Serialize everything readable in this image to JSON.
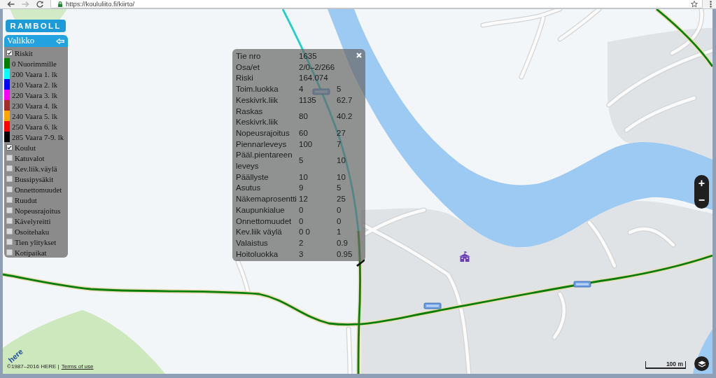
{
  "browser": {
    "url": "https://koululiito.fi/kiirto/"
  },
  "logo": {
    "text": "RAMBOLL"
  },
  "menu": {
    "title": "Valikko",
    "items": [
      {
        "kind": "checkbox",
        "label": "Riskit",
        "checked": true
      },
      {
        "kind": "legend",
        "label": "0 Nuorimmille",
        "color": "#008000"
      },
      {
        "kind": "legend",
        "label": "200 Vaara 1. lk",
        "color": "#00ffff"
      },
      {
        "kind": "legend",
        "label": "210 Vaara 2. lk",
        "color": "#0000ff"
      },
      {
        "kind": "legend",
        "label": "220 Vaara 3. lk",
        "color": "#ff00ff"
      },
      {
        "kind": "legend",
        "label": "230 Vaara 4. lk",
        "color": "#a52a2a"
      },
      {
        "kind": "legend",
        "label": "240 Vaara 5. lk",
        "color": "#ffa500"
      },
      {
        "kind": "legend",
        "label": "250 Vaara 6. lk",
        "color": "#ff0000"
      },
      {
        "kind": "legend",
        "label": "285 Vaara 7-9. lk",
        "color": "#000000"
      },
      {
        "kind": "checkbox",
        "label": "Koulut",
        "checked": true
      },
      {
        "kind": "checkbox",
        "label": "Katuvalot",
        "checked": false
      },
      {
        "kind": "checkbox",
        "label": "Kev.liik.väylä",
        "checked": false
      },
      {
        "kind": "checkbox",
        "label": "Bussipysäkit",
        "checked": false
      },
      {
        "kind": "checkbox",
        "label": "Onnettomuudet",
        "checked": false
      },
      {
        "kind": "checkbox",
        "label": "Ruudut",
        "checked": false
      },
      {
        "kind": "checkbox",
        "label": "Nopeusrajoitus",
        "checked": false
      },
      {
        "kind": "checkbox",
        "label": "Kävelyreitti",
        "checked": false
      },
      {
        "kind": "checkbox",
        "label": "Osoitehaku",
        "checked": false
      },
      {
        "kind": "checkbox",
        "label": "Tien ylitykset",
        "checked": false
      },
      {
        "kind": "checkbox",
        "label": "Kotipaikat",
        "checked": false
      }
    ]
  },
  "popup": {
    "rows": [
      {
        "label": "Tie nro",
        "values": [
          "1635"
        ]
      },
      {
        "label": "Osa/et",
        "values": [
          "2/0–2/266"
        ]
      },
      {
        "label": "Riski",
        "values": [
          "164.074"
        ]
      },
      {
        "label": "Toim.luokka",
        "values": [
          "4",
          "5"
        ]
      },
      {
        "label": "Keskivrk.liik",
        "values": [
          "1135",
          "62.7"
        ]
      },
      {
        "label": "Raskas Keskivrk.liik",
        "values": [
          "80",
          "40.2"
        ]
      },
      {
        "label": "Nopeusrajoitus",
        "values": [
          "60",
          "27"
        ]
      },
      {
        "label": "Piennarleveys",
        "values": [
          "100",
          "7"
        ]
      },
      {
        "label": "Pääl.pientareen leveys",
        "values": [
          "5",
          "10"
        ]
      },
      {
        "label": "Päällyste",
        "values": [
          "10",
          "10"
        ]
      },
      {
        "label": "Asutus",
        "values": [
          "9",
          "5"
        ]
      },
      {
        "label": "Näkemaprosentti",
        "values": [
          "12",
          "25"
        ]
      },
      {
        "label": "Kaupunkialue",
        "values": [
          "0",
          "0"
        ]
      },
      {
        "label": "Onnettomuudet",
        "values": [
          "0",
          "0"
        ]
      },
      {
        "label": "Kev.liik väylä",
        "values": [
          "0 0",
          "1"
        ]
      },
      {
        "label": "Valaistus",
        "values": [
          "2",
          "0.9"
        ]
      },
      {
        "label": "Hoitoluokka",
        "values": [
          "3",
          "0.95"
        ]
      }
    ]
  },
  "map": {
    "routes": [
      {
        "color": "#1fd1c8"
      },
      {
        "color": "#0a7d0a"
      },
      {
        "color": "#0a7d0a"
      },
      {
        "color": "#0a7d0a"
      }
    ],
    "zoom_in": "+",
    "zoom_out": "−",
    "scale": "100 m",
    "attribution": {
      "logo": "here",
      "text": "©1987–2016 HERE |",
      "link": "Terms of use"
    }
  }
}
